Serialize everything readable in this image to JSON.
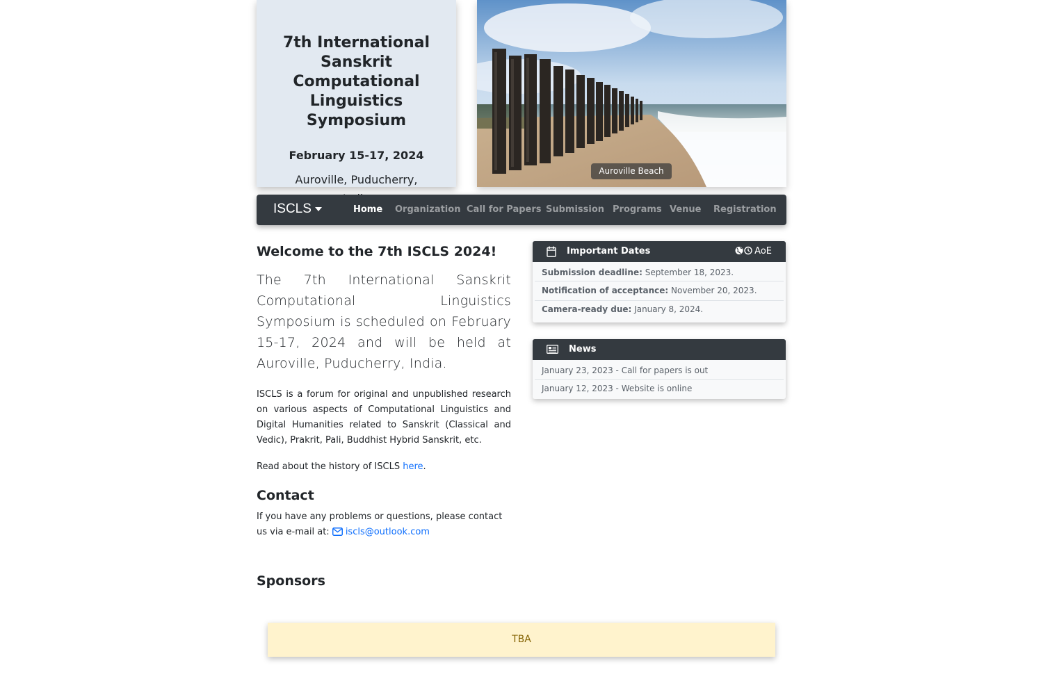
{
  "header": {
    "title": "7th International Sanskrit Computational Linguistics Symposium",
    "dates": "February 15-17, 2024",
    "location": "Auroville, Puducherry, India"
  },
  "hero": {
    "caption": "Auroville Beach",
    "image_icon": "beach-photo"
  },
  "navbar": {
    "brand": "ISCLS",
    "items": [
      {
        "label": "Home",
        "active": true
      },
      {
        "label": "Organization",
        "active": false
      },
      {
        "label": "Call for Papers",
        "active": false
      },
      {
        "label": "Submission",
        "active": false
      },
      {
        "label": "Programs",
        "active": false
      },
      {
        "label": "Venue",
        "active": false
      },
      {
        "label": "Registration",
        "active": false
      }
    ]
  },
  "main": {
    "welcome": "Welcome to the 7th ISCLS 2024!",
    "lead": "The 7th International Sanskrit Computational Linguistics Symposium is scheduled on February 15-17, 2024 and will be held at Auroville, Puducherry, India.",
    "description": "ISCLS is a forum for original and unpublished research on various aspects of Computational Linguistics and Digital Humanities related to Sanskrit (Classical and Vedic), Prakrit, Pali, Buddhist Hybrid Sanskrit, etc.",
    "history_prefix": "Read about the history of ISCLS ",
    "history_link": "here",
    "history_suffix": ".",
    "contact_heading": "Contact",
    "contact_text": "If you have any problems or questions, please contact us via e-mail at: ",
    "contact_email": "iscls@outlook.com"
  },
  "important_dates": {
    "heading": "Important Dates",
    "timezone": "AoE",
    "items": [
      {
        "label": "Submission deadline:",
        "value": "September 18, 2023."
      },
      {
        "label": "Notification of acceptance:",
        "value": "November 20, 2023."
      },
      {
        "label": "Camera-ready due:",
        "value": "January 8, 2024."
      }
    ]
  },
  "news": {
    "heading": "News",
    "items": [
      "January 23, 2023 - Call for papers is out",
      "January 12, 2023 - Website is online"
    ]
  },
  "sponsors": {
    "heading": "Sponsors",
    "status": "TBA"
  },
  "colors": {
    "navbar_bg": "#343a40",
    "header_card_bg": "#e2e9f1",
    "link": "#0d6efd",
    "tba_bg": "#fff3cd",
    "tba_text": "#856404"
  }
}
